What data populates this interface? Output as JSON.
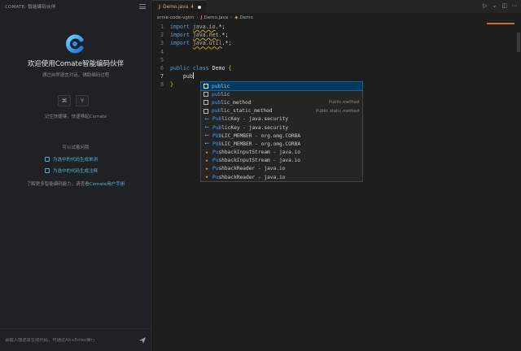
{
  "sidebar": {
    "header_title": "COMATE: 智能编码伙伴",
    "welcome_title": "欢迎使用Comate智能编码伙伴",
    "welcome_subtitle": "通过自然语言对话，辅助编码过程",
    "keys": [
      "⌘",
      "Y"
    ],
    "shortcut_hint": "记住快捷键，快速唤起Comate",
    "try_asking": "可以试着问我",
    "suggestions": [
      "为选中的代码生成单测",
      "为选中的代码生成注释"
    ],
    "learn_more_prefix": "了解更多智能编码能力，请查看",
    "learn_more_link": "Comate用户手册",
    "input_placeholder": "请输入描述来生成代码，可通过Alt+Enter换行"
  },
  "editor": {
    "tab": {
      "icon": "J",
      "name": "Demo.java",
      "problem_count": "4"
    },
    "breadcrumb": {
      "folder": "ernie-code-vgtm",
      "file": "Demo.java",
      "class": "Demo"
    },
    "lines": [
      {
        "n": "1",
        "kw": "import",
        "pkg": "java.io",
        "rest": ".*;"
      },
      {
        "n": "2",
        "kw": "import",
        "pkg": "java.net",
        "rest": ".*;"
      },
      {
        "n": "3",
        "kw": "import",
        "pkg": "java.util",
        "rest": ".*;"
      },
      {
        "n": "4"
      },
      {
        "n": "5"
      },
      {
        "n": "6",
        "code": "public class Demo {"
      },
      {
        "n": "7",
        "typed": "pub"
      },
      {
        "n": "8",
        "close": "}"
      }
    ],
    "suggestions": [
      {
        "icon": "keyword",
        "match": "pub",
        "label": "lic",
        "detail": ""
      },
      {
        "icon": "keyword",
        "match": "pub",
        "label": "lic",
        "detail": ""
      },
      {
        "icon": "keyword",
        "match": "pub",
        "label": "lic_method",
        "detail": "Public method"
      },
      {
        "icon": "keyword",
        "match": "pub",
        "label": "lic_static_method",
        "detail": "Public static method"
      },
      {
        "icon": "reference",
        "match": "Pub",
        "label": "licKey - java.security",
        "detail": ""
      },
      {
        "icon": "reference",
        "match": "Pub",
        "label": "licKey - java.security",
        "detail": ""
      },
      {
        "icon": "enum",
        "match": "PUB",
        "label": "LIC_MEMBER - org.omg.CORBA",
        "detail": ""
      },
      {
        "icon": "enum",
        "match": "PUB",
        "label": "LIC_MEMBER - org.omg.CORBA",
        "detail": ""
      },
      {
        "icon": "class",
        "match": "Pu",
        "label": "shbackInputStream - java.io",
        "detail": ""
      },
      {
        "icon": "class",
        "match": "Pu",
        "label": "shbackInputStream - java.io",
        "detail": ""
      },
      {
        "icon": "class",
        "match": "Pu",
        "label": "shbackReader - java.io",
        "detail": ""
      },
      {
        "icon": "class",
        "match": "Pu",
        "label": "shbackReader - java.io",
        "detail": ""
      }
    ]
  },
  "colors": {
    "accent": "#4fb3d9",
    "selection": "#04395e",
    "keyword": "#569cd6",
    "warning_tab": "#e8a57a"
  }
}
